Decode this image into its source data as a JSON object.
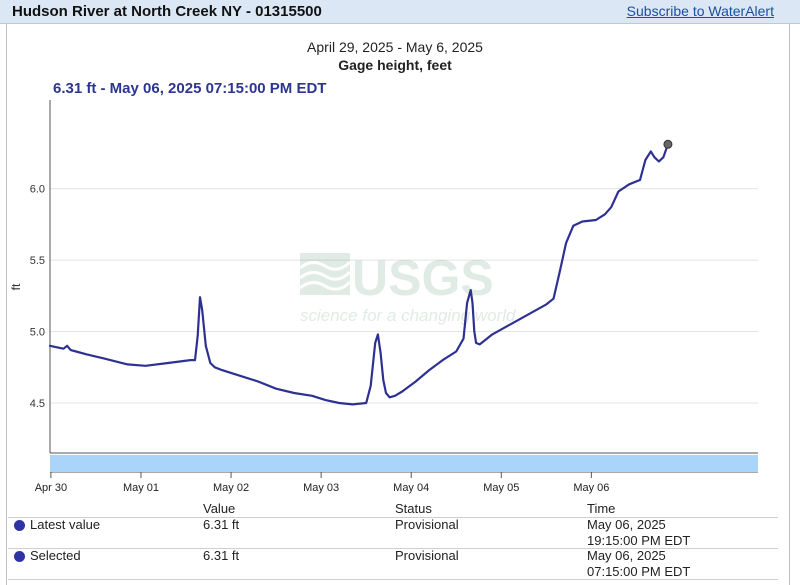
{
  "header": {
    "site_title": "Hudson River at North Creek NY - 01315500",
    "subscribe_label": "Subscribe to WaterAlert"
  },
  "chart_data": {
    "type": "line",
    "title": "April 29, 2025 - May 6, 2025",
    "subtitle": "Gage height, feet",
    "selected_readout": "6.31 ft - May 06, 2025 07:15:00 PM EDT",
    "xlabel": "",
    "ylabel": "ft",
    "ylim": [
      4.15,
      6.62
    ],
    "yticks": [
      4.5,
      5.0,
      5.5,
      6.0
    ],
    "ytick_labels": [
      "4.5",
      "5.0",
      "5.5",
      "6.0"
    ],
    "x_unit": "days since April 30 00:00 (tick positions)",
    "xlim": [
      -0.01,
      7.85
    ],
    "xticks": [
      0,
      1,
      2,
      3,
      4,
      5,
      6
    ],
    "xtick_labels": [
      "Apr 30",
      "May 01",
      "May 02",
      "May 03",
      "May 04",
      "May 05",
      "May 06"
    ],
    "grid": true,
    "watermark": {
      "logo": "USGS",
      "tagline": "science for a changing world"
    },
    "series": [
      {
        "name": "",
        "color": "#2e3192",
        "x": [
          -0.01,
          0.06,
          0.14,
          0.18,
          0.22,
          0.28,
          0.4,
          0.6,
          0.85,
          1.05,
          1.3,
          1.55,
          1.6,
          1.63,
          1.655,
          1.68,
          1.72,
          1.77,
          1.82,
          1.9,
          2.1,
          2.3,
          2.5,
          2.7,
          2.9,
          3.05,
          3.2,
          3.35,
          3.5,
          3.55,
          3.6,
          3.63,
          3.66,
          3.69,
          3.72,
          3.76,
          3.82,
          3.9,
          4.05,
          4.2,
          4.35,
          4.5,
          4.58,
          4.62,
          4.66,
          4.68,
          4.7,
          4.72,
          4.76,
          4.82,
          4.9,
          5.1,
          5.3,
          5.5,
          5.58,
          5.65,
          5.72,
          5.8,
          5.9,
          6.05,
          6.15,
          6.22,
          6.3,
          6.42,
          6.54,
          6.6,
          6.66,
          6.7,
          6.75,
          6.8,
          6.85
        ],
        "y": [
          4.9,
          4.89,
          4.88,
          4.9,
          4.87,
          4.86,
          4.84,
          4.81,
          4.77,
          4.76,
          4.78,
          4.8,
          4.8,
          4.97,
          5.24,
          5.15,
          4.9,
          4.78,
          4.75,
          4.73,
          4.69,
          4.65,
          4.6,
          4.57,
          4.55,
          4.52,
          4.5,
          4.49,
          4.5,
          4.62,
          4.92,
          4.98,
          4.85,
          4.66,
          4.57,
          4.54,
          4.55,
          4.58,
          4.65,
          4.73,
          4.8,
          4.86,
          4.95,
          5.2,
          5.29,
          5.2,
          5.0,
          4.92,
          4.91,
          4.94,
          4.98,
          5.05,
          5.12,
          5.19,
          5.23,
          5.42,
          5.62,
          5.74,
          5.77,
          5.78,
          5.82,
          5.87,
          5.98,
          6.03,
          6.06,
          6.2,
          6.26,
          6.22,
          6.19,
          6.22,
          6.31
        ]
      }
    ]
  },
  "table": {
    "headers": {
      "value": "Value",
      "status": "Status",
      "time": "Time"
    },
    "rows": [
      {
        "label": "Latest value",
        "value": "6.31 ft",
        "status": "Provisional",
        "time_date": "May 06, 2025",
        "time_clock": "19:15:00 PM EDT"
      },
      {
        "label": "Selected",
        "value": "6.31 ft",
        "status": "Provisional",
        "time_date": "May 06, 2025",
        "time_clock": "07:15:00 PM EDT"
      }
    ]
  }
}
